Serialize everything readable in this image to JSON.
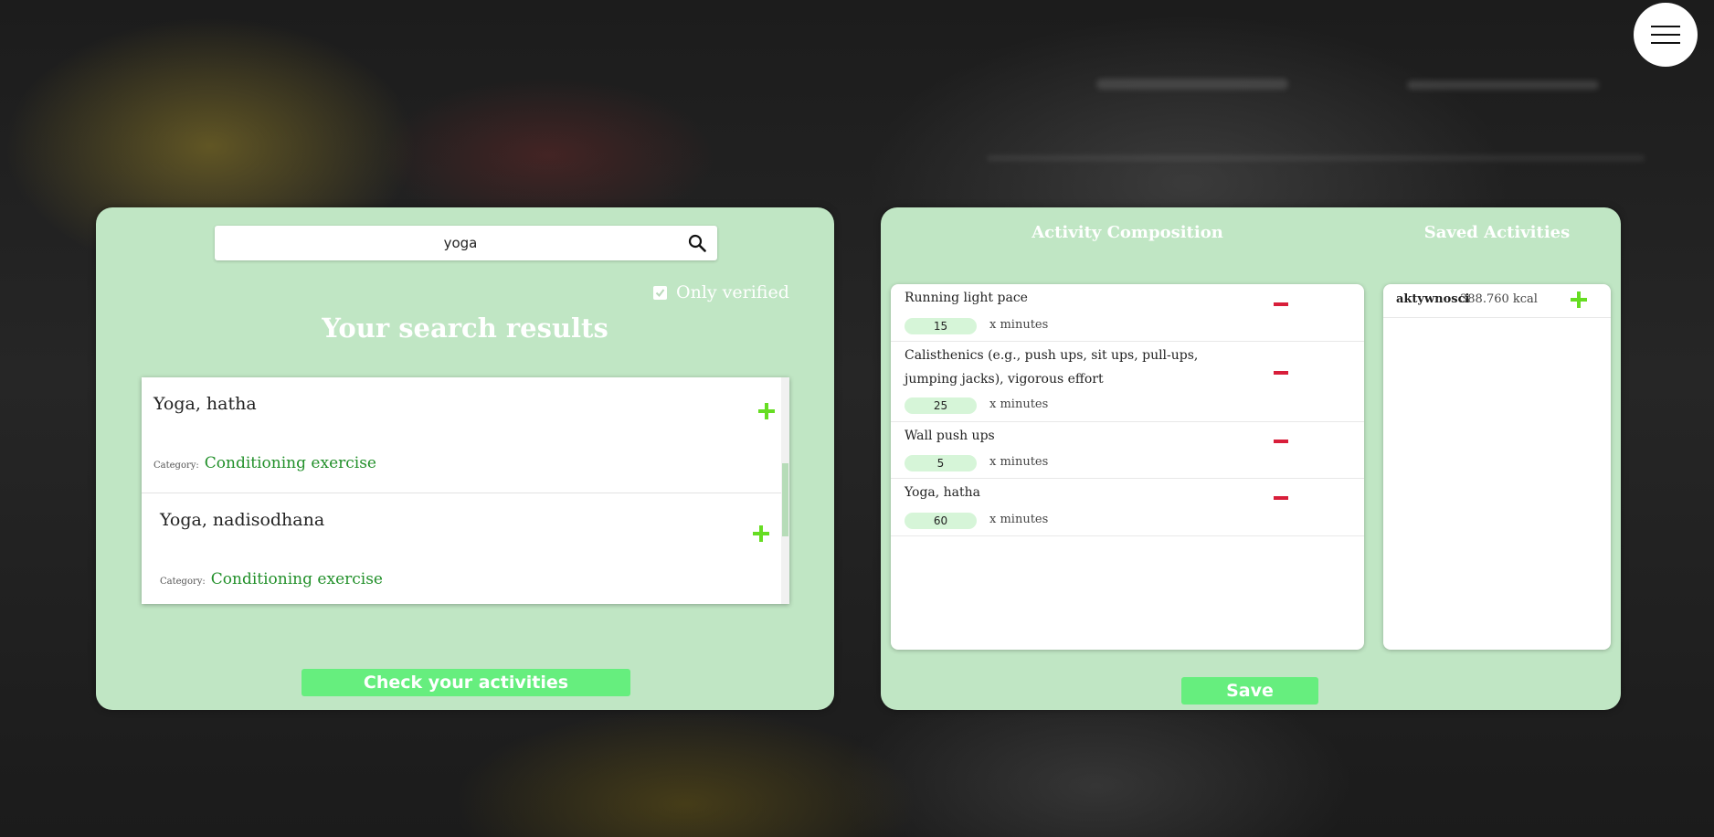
{
  "search": {
    "query": "yoga",
    "only_verified_label": "Only verified",
    "only_verified_checked": true,
    "results_title": "Your search results",
    "category_label": "Category:",
    "results": [
      {
        "name": "Yoga, hatha",
        "category": "Conditioning exercise"
      },
      {
        "name": "Yoga, nadisodhana",
        "category": "Conditioning exercise"
      }
    ],
    "check_button": "Check your activities"
  },
  "composition": {
    "title": "Activity Composition",
    "minutes_suffix": "x minutes",
    "items": [
      {
        "name": "Running light pace",
        "minutes": "15"
      },
      {
        "name": "Calisthenics (e.g., push ups, sit ups, pull-ups, jumping jacks), vigorous effort",
        "minutes": "25"
      },
      {
        "name": "Wall push ups",
        "minutes": "5"
      },
      {
        "name": "Yoga, hatha",
        "minutes": "60"
      }
    ],
    "save_button": "Save"
  },
  "saved": {
    "title": "Saved Activities",
    "items": [
      {
        "name": "aktywnosci",
        "kcal": "388.760 kcal"
      }
    ]
  },
  "icons": {
    "menu": "hamburger-menu-icon",
    "search": "search-icon",
    "add": "plus-icon",
    "remove": "minus-icon"
  },
  "colors": {
    "panel": "#c0e6c4",
    "button": "#66ee7e",
    "add": "#66dd22",
    "remove": "#d81e3a",
    "category": "#22902a"
  }
}
